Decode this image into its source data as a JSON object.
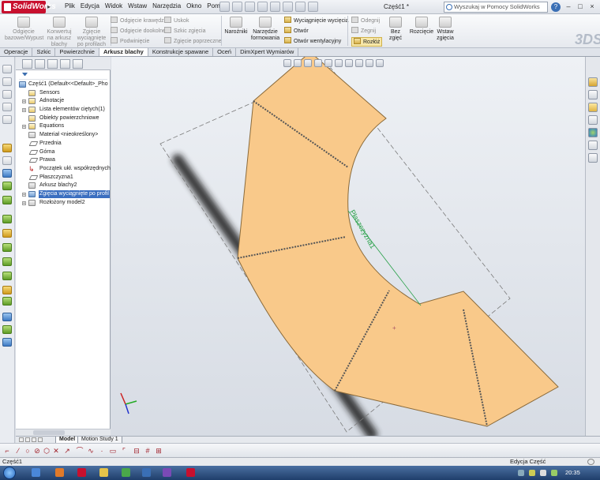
{
  "app": {
    "name": "SolidWorks",
    "document_title": "Część1 *"
  },
  "menu": [
    "Plik",
    "Edycja",
    "Widok",
    "Wstaw",
    "Narzędzia",
    "Okno",
    "Pomoc"
  ],
  "search": {
    "placeholder": "Wyszukaj w Pomocy SolidWorks"
  },
  "commands": {
    "large": [
      {
        "label": "Odgięcie bazowe/Wypust"
      },
      {
        "label": "Konwertuj na arkusz blachy"
      },
      {
        "label": "Zgięcie wyciągnięte po profilach"
      }
    ],
    "col1": [
      "Odgięcie krawędzi",
      "Odgięcie dookolne",
      "Podwinięcie"
    ],
    "col2": [
      "Uskok",
      "Szkic zgięcia",
      "Zgięcie poprzeczne"
    ],
    "narozniki": "Naroźniki",
    "narzedzie": "Narzędzie formowania",
    "col3": [
      "Wyciągnięcie wycięcia",
      "Otwór",
      "Otwór wentylacyjny"
    ],
    "col4": [
      "Odegnij",
      "Zegnij",
      "Rozłóż"
    ],
    "bez_zgiec": "Bez zgięć",
    "rozcięcie": "Rozcięcie",
    "wstaw_zgiecia": "Wstaw zgięcia"
  },
  "tabs": [
    "Operacje",
    "Szkic",
    "Powierzchnie",
    "Arkusz blachy",
    "Konstrukcje spawane",
    "Oceń",
    "DimXpert Wymiarów"
  ],
  "active_tab": "Arkusz blachy",
  "tree": [
    {
      "label": "Część1  (Default<<Default>_Pho",
      "indent": 0,
      "icon": "part"
    },
    {
      "label": "Sensors",
      "indent": 1,
      "icon": "folder"
    },
    {
      "label": "Adnotacje",
      "indent": 1,
      "icon": "folder"
    },
    {
      "label": "Lista elementów ciętych(1)",
      "indent": 1,
      "icon": "folder"
    },
    {
      "label": "Obiekty powierzchniowe",
      "indent": 1,
      "icon": "folder"
    },
    {
      "label": "Equations",
      "indent": 1,
      "icon": "folder"
    },
    {
      "label": "Materiał <nieokreślony>",
      "indent": 1,
      "icon": "material"
    },
    {
      "label": "Przednia",
      "indent": 1,
      "icon": "plane"
    },
    {
      "label": "Górna",
      "indent": 1,
      "icon": "plane"
    },
    {
      "label": "Prawa",
      "indent": 1,
      "icon": "plane"
    },
    {
      "label": "Początek ukł. współrzędnych",
      "indent": 1,
      "icon": "origin"
    },
    {
      "label": "Płaszczyzna1",
      "indent": 1,
      "icon": "plane"
    },
    {
      "label": "Arkusz blachy2",
      "indent": 1,
      "icon": "sheet"
    },
    {
      "label": "Zgięcia wyciągnięte po profil",
      "indent": 1,
      "icon": "loft",
      "selected": true
    },
    {
      "label": "Rozłożony model2",
      "indent": 1,
      "icon": "flat"
    }
  ],
  "bottom_tabs": [
    "Model",
    "Motion Study 1"
  ],
  "viewport": {
    "plane_label": "Płaszczyzna1"
  },
  "status": {
    "left": "Część1",
    "right": "Edycja Część"
  },
  "taskbar": {
    "clock": "20:35"
  },
  "colors": {
    "part_face": "#f9c98a",
    "selection": "#3b6fc0",
    "plane_label": "#2aa14a",
    "brand": "#c8102e"
  }
}
